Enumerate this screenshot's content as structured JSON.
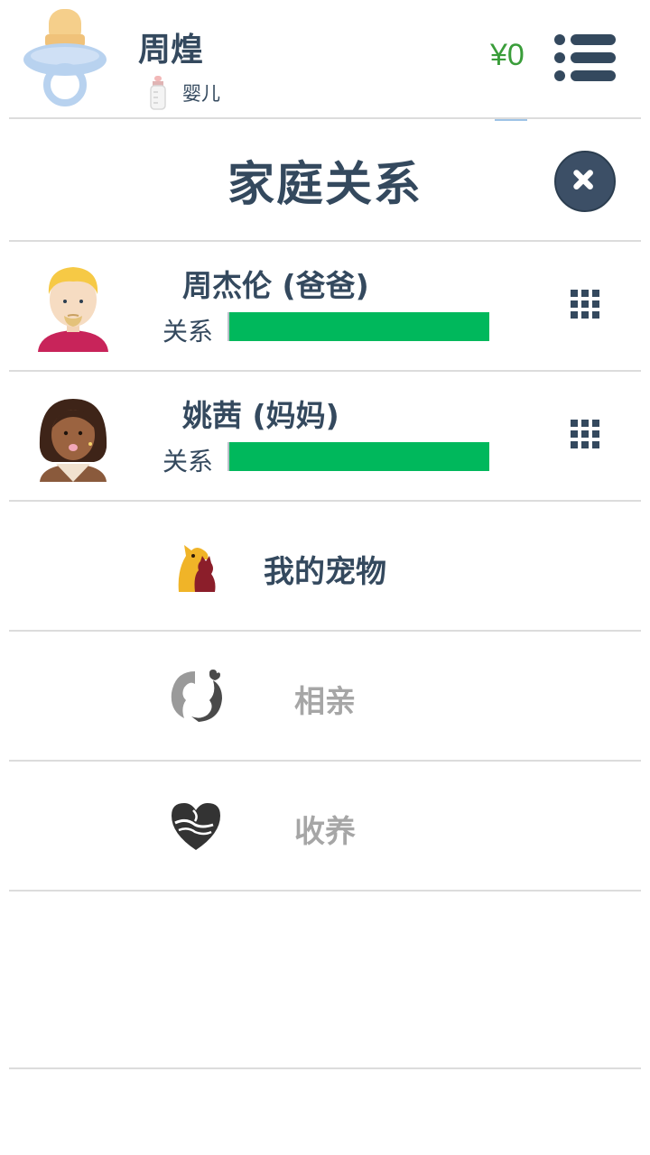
{
  "header": {
    "player_name": "周煌",
    "life_stage": "婴儿",
    "money": "¥0",
    "avatar_icon": "pacifier-icon",
    "stage_icon": "baby-bottle-icon",
    "menu_icon": "menu-list-icon"
  },
  "section": {
    "title": "家庭关系",
    "close_icon": "close-icon"
  },
  "family": [
    {
      "name": "周杰伦 (爸爸)",
      "relation_label": "关系",
      "relation_level": 1.0,
      "avatar_icon": "father-avatar-icon"
    },
    {
      "name": "姚茜 (妈妈)",
      "relation_label": "关系",
      "relation_level": 1.0,
      "avatar_icon": "mother-avatar-icon"
    }
  ],
  "actions": [
    {
      "label": "我的宠物",
      "icon": "pet-icon",
      "enabled": true
    },
    {
      "label": "相亲",
      "icon": "dating-icon",
      "enabled": false
    },
    {
      "label": "收养",
      "icon": "adoption-heart-icon",
      "enabled": false
    }
  ],
  "colors": {
    "text_primary": "#34495e",
    "money_green": "#3a9d3a",
    "relation_fill": "#00b85c",
    "disabled_text": "#a6a6a6",
    "close_button": "#3c4f66"
  }
}
